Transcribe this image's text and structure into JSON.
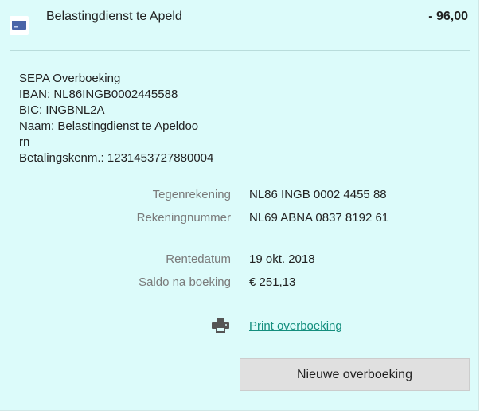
{
  "transaction": {
    "counterparty": "Belastingdienst te Apeld",
    "amount": "- 96,00"
  },
  "description": {
    "lines": [
      "SEPA Overboeking",
      "IBAN: NL86INGB0002445588",
      "BIC: INGBNL2A",
      "Naam: Belastingdienst te Apeldoo",
      "rn",
      "Betalingskenm.: 1231453727880004"
    ]
  },
  "details": {
    "tegenrekening": {
      "label": "Tegenrekening",
      "value": "NL86 INGB 0002 4455 88"
    },
    "rekeningnummer": {
      "label": "Rekeningnummer",
      "value": "NL69 ABNA 0837 8192 61"
    },
    "rentedatum": {
      "label": "Rentedatum",
      "value": "19 okt. 2018"
    },
    "saldo": {
      "label": "Saldo na boeking",
      "value": "€ 251,13"
    }
  },
  "actions": {
    "print_label": "Print overboeking",
    "new_transfer_label": "Nieuwe overboeking"
  },
  "icons": {
    "bank": "bank-card-icon",
    "print": "printer-icon"
  },
  "colors": {
    "card_background": "#dcfbfa",
    "link": "#138e7d",
    "label": "#7a7a7a",
    "button": "#e0e0e0",
    "bank_icon": "#4a64a8"
  }
}
